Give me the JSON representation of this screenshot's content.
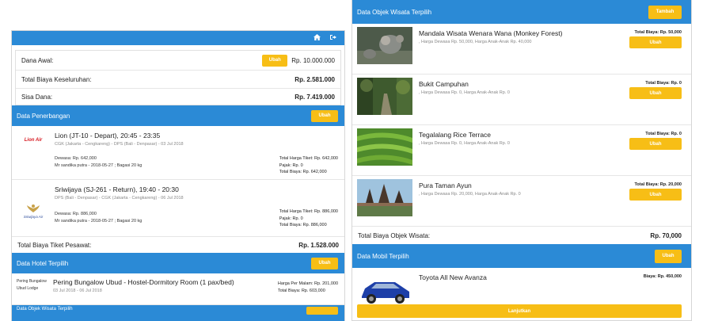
{
  "left": {
    "summary": {
      "dana_awal_label": "Dana Awal:",
      "dana_awal_button": "Ubah",
      "dana_awal_value": "Rp. 10.000.000",
      "total_label": "Total Biaya Keseluruhan:",
      "total_value": "Rp. 2.581.000",
      "sisa_label": "Sisa Dana:",
      "sisa_value": "Rp. 7.419.000"
    },
    "penerbangan": {
      "title": "Data Penerbangan",
      "button": "Ubah",
      "flights": [
        {
          "logo_text": "Lion Air",
          "title": "Lion (JT-10 - Depart), 20:45 - 23:35",
          "route": "CGK (Jakarta - Cengkareng) - DPS (Bali - Denpasar) - 03 Jul 2018",
          "passenger_line1": "Dewasa: Rp. 642,000",
          "passenger_line2": "Mr sandika putra - 2018-05-27 ; Bagasi 20 kg",
          "harga_tiket": "Total Harga Tiket: Rp. 642,000",
          "pajak": "Pajak: Rp. 0",
          "total": "Total Biaya: Rp. 642,000"
        },
        {
          "logo_text": "Sriwijaya Air",
          "title": "Sriwijaya (SJ-261 - Return), 19:40 - 20:30",
          "route": "DPS (Bali - Denpasar) - CGK (Jakarta - Cengkareng) - 06 Jul 2018",
          "passenger_line1": "Dewasa: Rp. 886,000",
          "passenger_line2": "Mr sandika putra - 2018-05-27 ; Bagasi 20 kg",
          "harga_tiket": "Total Harga Tiket: Rp. 886,000",
          "pajak": "Pajak: Rp. 0",
          "total": "Total Biaya: Rp. 886,000"
        }
      ],
      "total_label": "Total Biaya Tiket Pesawat:",
      "total_value": "Rp. 1.528.000"
    },
    "hotel": {
      "title": "Data Hotel Terpilih",
      "button": "Ubah",
      "thumb_text": "Pering Bungalow Ubud Lodge",
      "name": "Pering Bungalow Ubud - Hostel-Dormitory Room (1 pax/bed)",
      "dates": "03 Jul 2018 - 06 Jul 2018",
      "harga_per_malam": "Harga Per Malam: Rp. 201,000",
      "total": "Total Biaya: Rp. 603,000"
    },
    "next_section_title": "Data Objek Wisata Terpilih"
  },
  "right": {
    "wisata": {
      "title": "Data Objek Wisata Terpilih",
      "button": "Tambah",
      "items": [
        {
          "name": "Mandala Wisata Wenara Wana (Monkey Forest)",
          "price": ", Harga Dewasa Rp. 50,000, Harga Anak-Anak Rp. 40,000",
          "total": "Total Biaya: Rp. 50,000",
          "button": "Ubah"
        },
        {
          "name": "Bukit Campuhan",
          "price": ", Harga Dewasa Rp. 0, Harga Anak-Anak Rp. 0",
          "total": "Total Biaya: Rp. 0",
          "button": "Ubah"
        },
        {
          "name": "Tegalalang Rice Terrace",
          "price": ", Harga Dewasa Rp. 0, Harga Anak-Anak Rp. 0",
          "total": "Total Biaya: Rp. 0",
          "button": "Ubah"
        },
        {
          "name": "Pura Taman Ayun",
          "price": ", Harga Dewasa Rp. 20,000, Harga Anak-Anak Rp. 0",
          "total": "Total Biaya: Rp. 20,000",
          "button": "Ubah"
        }
      ],
      "total_label": "Total Biaya Objek Wisata:",
      "total_value": "Rp. 70,000"
    },
    "mobil": {
      "title": "Data Mobil Terpilih",
      "button": "Ubah",
      "name": "Toyota All New Avanza",
      "biaya": "Biaya: Rp. 450,000"
    },
    "lanjutkan_button": "Lanjutkan"
  },
  "colors": {
    "header_blue": "#2b8ad6",
    "button_yellow": "#f7be16"
  },
  "icons": [
    "home-icon",
    "sign-out-icon"
  ]
}
